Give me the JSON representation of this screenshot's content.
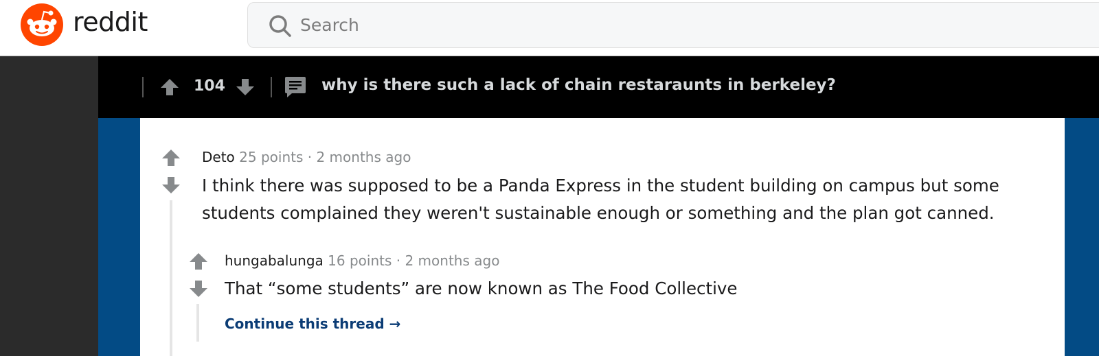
{
  "header": {
    "brand": "reddit",
    "search": {
      "placeholder": "Search",
      "value": ""
    }
  },
  "post": {
    "score": "104",
    "title": "why is there such a lack of chain restaraunts in berkeley?"
  },
  "comments": [
    {
      "author": "Deto",
      "points": "25 points",
      "separator": "·",
      "age": "2 months ago",
      "body": "I think there was supposed to be a Panda Express in the student building on campus but some students complained they weren't sustainable enough or something and the plan got canned.",
      "replies": [
        {
          "author": "hungabalunga",
          "points": "16 points",
          "separator": "·",
          "age": "2 months ago",
          "body": "That “some students” are now known as The Food Collective"
        }
      ]
    }
  ],
  "continue_thread": {
    "label": "Continue this thread",
    "arrow": "→"
  },
  "colors": {
    "brand_orange": "#ff4500",
    "post_bar": "#000000",
    "frame_blue": "#034b85",
    "link_blue": "#0b3c75",
    "vote_gray": "#878a8c"
  },
  "icons": [
    "reddit-logo-icon",
    "search-icon",
    "upvote-icon",
    "downvote-icon",
    "comments-icon",
    "arrow-right-icon"
  ]
}
